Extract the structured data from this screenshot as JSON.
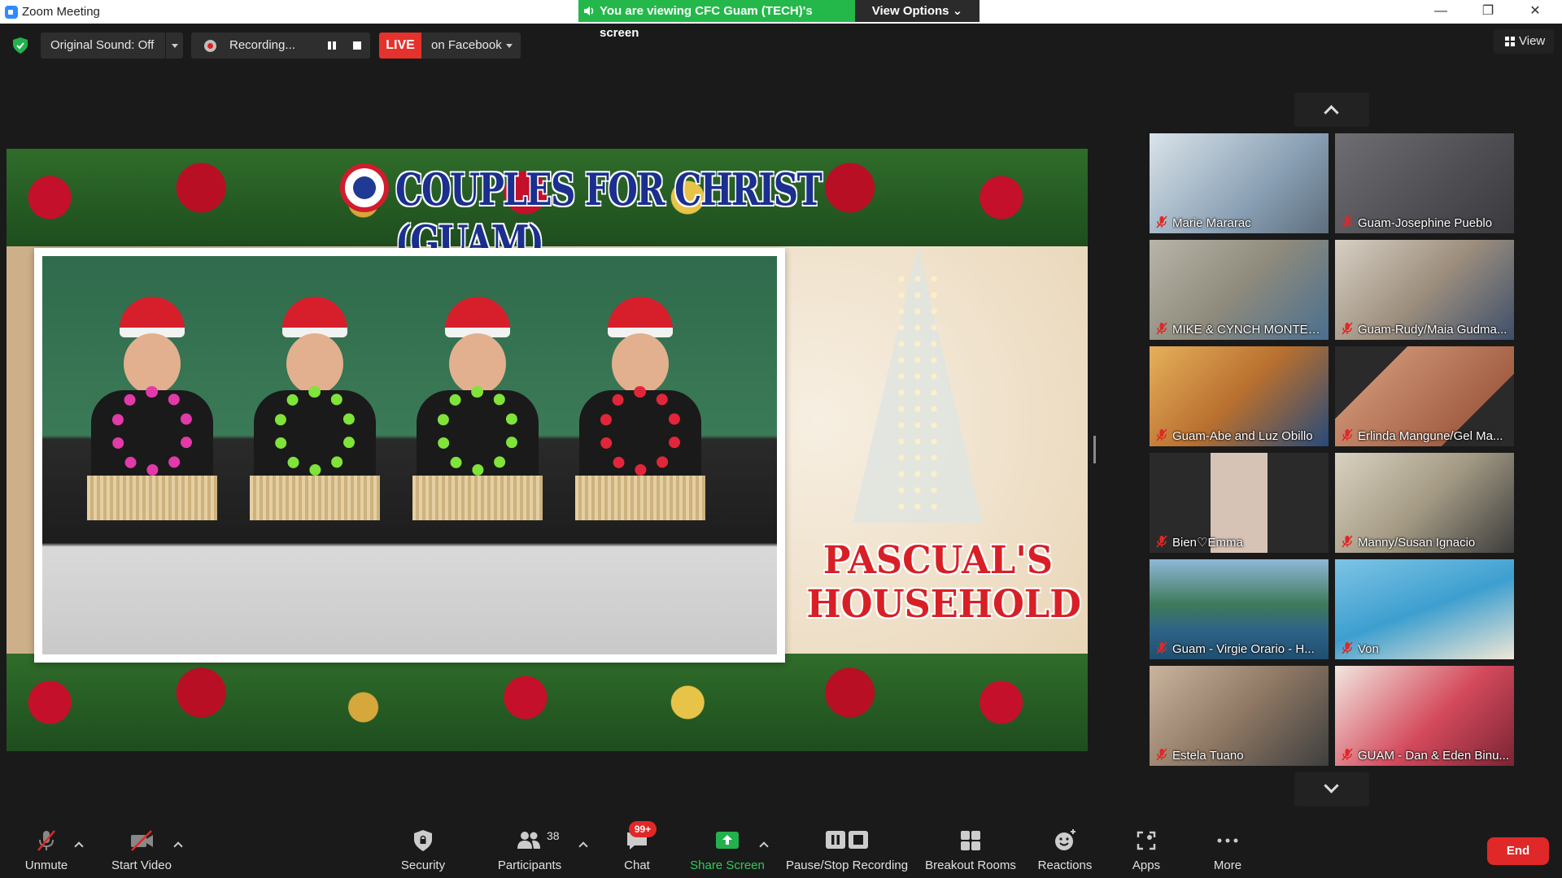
{
  "window": {
    "title": "Zoom Meeting",
    "minimize_label": "—",
    "restore_label": "❐",
    "close_label": "✕"
  },
  "share_banner": {
    "text": "You are viewing CFC Guam (TECH)'s screen",
    "view_options_label": "View Options ⌄"
  },
  "top_toolbar": {
    "original_sound_label": "Original Sound: Off",
    "recording_label": "Recording...",
    "live_label": "LIVE",
    "live_target_label": "on Facebook",
    "view_label": "View"
  },
  "shared_screen": {
    "org_title": "COUPLES FOR CHRIST (GUAM)",
    "household_line1": "PASCUAL'S",
    "household_line2": "HOUSEHOLD"
  },
  "gallery": {
    "participants": [
      {
        "name": "Marie Mararac",
        "muted": true
      },
      {
        "name": "Guam-Josephine Pueblo",
        "muted": true
      },
      {
        "name": "MIKE & CYNCH MONTEN...",
        "muted": true
      },
      {
        "name": "Guam-Rudy/Maia Gudma...",
        "muted": true
      },
      {
        "name": "Guam-Abe and Luz Obillo",
        "muted": true
      },
      {
        "name": "Erlinda Mangune/Gel Ma...",
        "muted": true
      },
      {
        "name": "Bien♡Emma",
        "muted": true
      },
      {
        "name": "Manny/Susan Ignacio",
        "muted": true
      },
      {
        "name": "Guam - Virgie Orario - H...",
        "muted": true
      },
      {
        "name": "Von",
        "muted": true
      },
      {
        "name": "Estela Tuano",
        "muted": true
      },
      {
        "name": "GUAM - Dan & Eden Binu...",
        "muted": true
      }
    ]
  },
  "bottom_toolbar": {
    "unmute_label": "Unmute",
    "start_video_label": "Start Video",
    "security_label": "Security",
    "participants_label": "Participants",
    "participants_count": "38",
    "chat_label": "Chat",
    "chat_badge": "99+",
    "share_screen_label": "Share Screen",
    "pause_stop_label": "Pause/Stop Recording",
    "breakout_label": "Breakout Rooms",
    "reactions_label": "Reactions",
    "apps_label": "Apps",
    "more_label": "More",
    "end_label": "End"
  },
  "colors": {
    "share_green": "#24b84b",
    "live_red": "#e5322d",
    "end_red": "#e02828",
    "mute_red": "#e02828"
  }
}
